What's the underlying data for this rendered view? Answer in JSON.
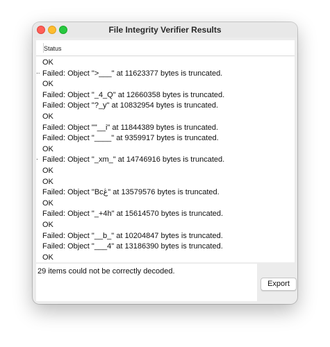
{
  "window": {
    "title": "File Integrity Verifier Results"
  },
  "table": {
    "column_header": "Status",
    "rows": [
      {
        "marker": "",
        "text": "OK"
      },
      {
        "marker": "..",
        "text": "Failed: Object \">___\" at 11623377 bytes is truncated."
      },
      {
        "marker": "",
        "text": "OK"
      },
      {
        "marker": "",
        "text": "Failed: Object \"_4_Q\" at 12660358 bytes is truncated."
      },
      {
        "marker": "",
        "text": "Failed: Object \"?_y\" at 10832954 bytes is truncated."
      },
      {
        "marker": "",
        "text": "OK"
      },
      {
        "marker": "",
        "text": "Failed: Object \"\"__i\" at 11844389 bytes is truncated."
      },
      {
        "marker": "",
        "text": "Failed: Object \"____\" at 9359917 bytes is truncated."
      },
      {
        "marker": "",
        "text": "OK"
      },
      {
        "marker": ".",
        "text": "Failed: Object \"_xm_\" at 14746916 bytes is truncated."
      },
      {
        "marker": "",
        "text": "OK"
      },
      {
        "marker": "",
        "text": "OK"
      },
      {
        "marker": "",
        "text": "Failed: Object \"Bcڠ\" at 13579576 bytes is truncated."
      },
      {
        "marker": "",
        "text": "OK"
      },
      {
        "marker": "",
        "text": "Failed: Object \"_+4h\" at 15614570 bytes is truncated."
      },
      {
        "marker": "",
        "text": "OK"
      },
      {
        "marker": "",
        "text": "Failed: Object \"__b_\" at 10204847 bytes is truncated."
      },
      {
        "marker": "",
        "text": "Failed: Object \"___4\" at 13186390 bytes is truncated."
      },
      {
        "marker": "",
        "text": "OK"
      }
    ]
  },
  "summary": {
    "text": "29 items could not be correctly decoded."
  },
  "buttons": {
    "export_label": "Export"
  },
  "colors": {
    "close": "#ff5f57",
    "minimize": "#febc2e",
    "maximize": "#28c840"
  }
}
